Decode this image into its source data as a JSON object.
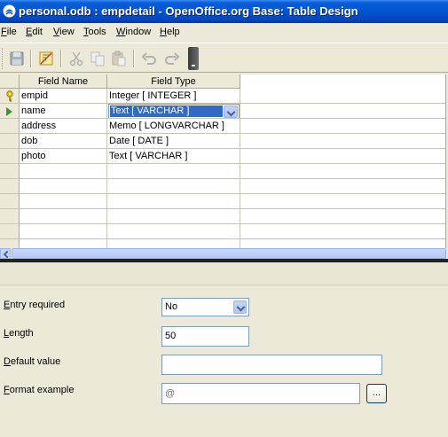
{
  "window": {
    "title": "personal.odb : empdetail - OpenOffice.org Base: Table Design"
  },
  "menu": [
    {
      "label": "File",
      "mnemonic": "F",
      "rest": "ile"
    },
    {
      "label": "Edit",
      "mnemonic": "E",
      "rest": "dit"
    },
    {
      "label": "View",
      "mnemonic": "V",
      "rest": "iew"
    },
    {
      "label": "Tools",
      "mnemonic": "T",
      "rest": "ools"
    },
    {
      "label": "Window",
      "mnemonic": "W",
      "rest": "indow"
    },
    {
      "label": "Help",
      "mnemonic": "H",
      "rest": "elp"
    }
  ],
  "toolbar": {
    "icons": [
      "save-icon",
      "index-design-icon",
      "cut-icon",
      "copy-icon",
      "paste-icon",
      "undo-icon",
      "redo-icon"
    ]
  },
  "grid": {
    "headers": {
      "field_name": "Field Name",
      "field_type": "Field Type"
    },
    "rows": [
      {
        "name": "empid",
        "type": "Integer [ INTEGER ]",
        "primary_key": true
      },
      {
        "name": "name",
        "type": "Text [ VARCHAR ]",
        "current": true
      },
      {
        "name": "address",
        "type": "Memo [ LONGVARCHAR ]"
      },
      {
        "name": "dob",
        "type": "Date [ DATE ]"
      },
      {
        "name": "photo",
        "type": "Text [ VARCHAR ]"
      }
    ]
  },
  "properties": {
    "entry_required": {
      "mnemonic": "E",
      "rest": "ntry required",
      "value": "No"
    },
    "length": {
      "mnemonic": "L",
      "rest": "ength",
      "value": "50"
    },
    "default_value": {
      "mnemonic": "D",
      "rest": "efault value",
      "value": ""
    },
    "format_example": {
      "mnemonic": "F",
      "rest": "ormat example",
      "value": "@",
      "button": "..."
    }
  },
  "colors": {
    "title_bar": "#0553d0",
    "selection": "#316ac5",
    "chrome": "#ece9d8"
  }
}
